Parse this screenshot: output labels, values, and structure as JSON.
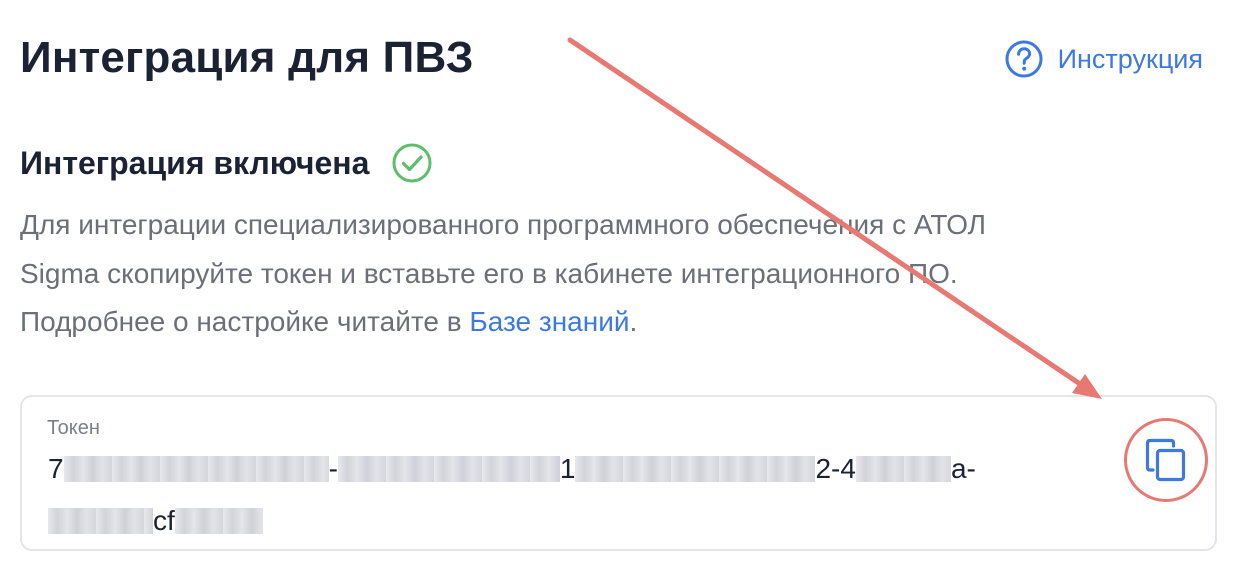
{
  "header": {
    "title": "Интеграция для ПВЗ",
    "help_link": {
      "label": "Инструкция",
      "icon": "question-circle-icon",
      "color": "#3c79e0"
    }
  },
  "integration": {
    "status_title": "Интеграция включена",
    "status_icon": "check-circle-icon",
    "status_color": "#5dbf6a",
    "description_line1": "Для интеграции специализированного программного обеспечения с АТОЛ",
    "description_line2": "Sigma скопируйте токен и вставьте его в кабинете интеграционного ПО.",
    "description_line3_prefix": "Подробнее о настройке читайте в ",
    "knowledge_base_link": "Базе знаний",
    "description_line3_suffix": "."
  },
  "token": {
    "label": "Токен",
    "line1_parts": [
      "7",
      "-",
      "1",
      "",
      "2-4",
      "a-"
    ],
    "line2_parts": [
      "cf"
    ],
    "copy_icon": "copy-icon"
  },
  "annotation": {
    "color": "#e77972"
  }
}
